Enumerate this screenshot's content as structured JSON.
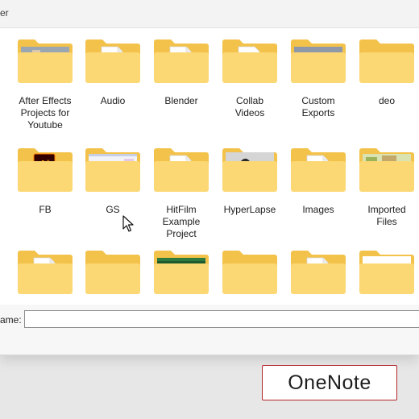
{
  "window": {
    "title_fragment": "er"
  },
  "folders": [
    {
      "label": "After Effects\nProjects for\nYoutube",
      "kind": "image-landscape"
    },
    {
      "label": "Audio",
      "kind": "paper"
    },
    {
      "label": "Blender",
      "kind": "paper"
    },
    {
      "label": "Collab\nVideos",
      "kind": "paper-photo"
    },
    {
      "label": "Custom\nExports",
      "kind": "image-sky"
    },
    {
      "label": "deo",
      "kind": "empty"
    },
    {
      "label": "FB",
      "kind": "ai-icon",
      "icon_text": "Ai"
    },
    {
      "label": "GS",
      "kind": "screenshot"
    },
    {
      "label": "HitFilm\nExample\nProject",
      "kind": "paper"
    },
    {
      "label": "HyperLapse",
      "kind": "image-dark"
    },
    {
      "label": "Images",
      "kind": "paper"
    },
    {
      "label": "Imported\nFiles",
      "kind": "image-green"
    },
    {
      "label": "",
      "kind": "paper"
    },
    {
      "label": "",
      "kind": "empty"
    },
    {
      "label": "",
      "kind": "green-card"
    },
    {
      "label": "",
      "kind": "empty"
    },
    {
      "label": "",
      "kind": "paper"
    },
    {
      "label": "",
      "kind": "bow"
    }
  ],
  "footer": {
    "filename_label": "ame:",
    "filename_value": ""
  },
  "watermark": {
    "text": "OneNote"
  },
  "colors": {
    "folder_back": "#f3c24a",
    "folder_front": "#fbd874",
    "accent_red": "#b3262a"
  }
}
